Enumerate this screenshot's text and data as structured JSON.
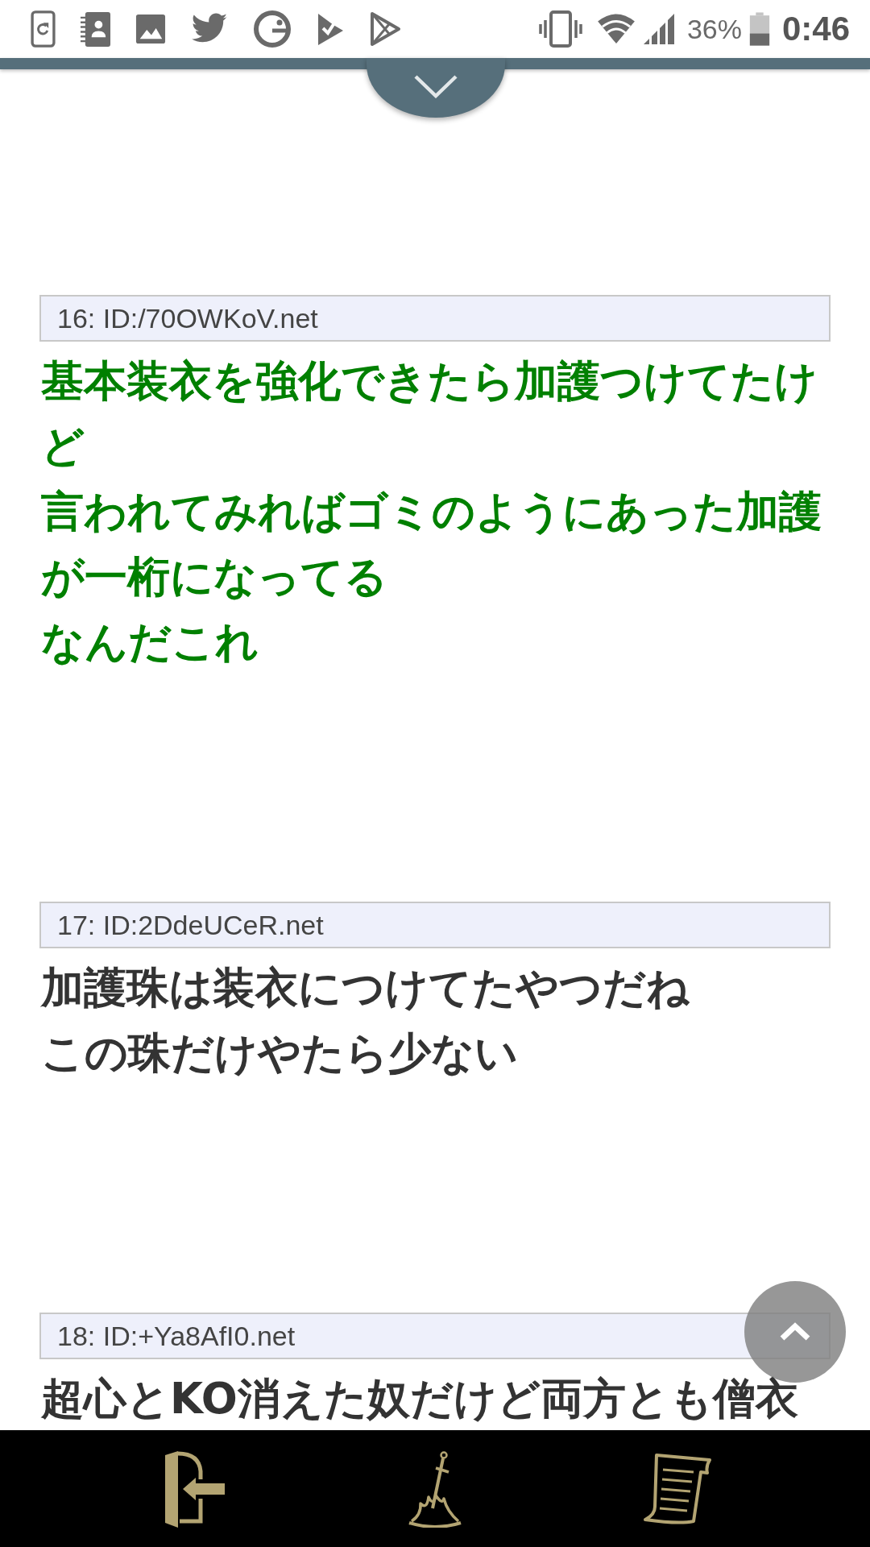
{
  "status_bar": {
    "battery": "36%",
    "time": "0:46"
  },
  "posts": [
    {
      "header": "16: ID:/70OWKoV.net",
      "lines": [
        "基本装衣を強化できたら加護つけてたけど",
        "言われてみればゴミのようにあった加護が一桁になってる",
        "なんだこれ"
      ],
      "color": "#008000"
    },
    {
      "header": "17: ID:2DdeUCeR.net",
      "lines": [
        "加護珠は装衣につけてたやつだね",
        "この珠だけやたら少ない"
      ],
      "color": "#333333"
    },
    {
      "header": "18: ID:+Ya8AfI0.net",
      "lines": [
        "超心とKO消えた奴だけど両方とも僧衣"
      ],
      "color": "#333333"
    }
  ]
}
